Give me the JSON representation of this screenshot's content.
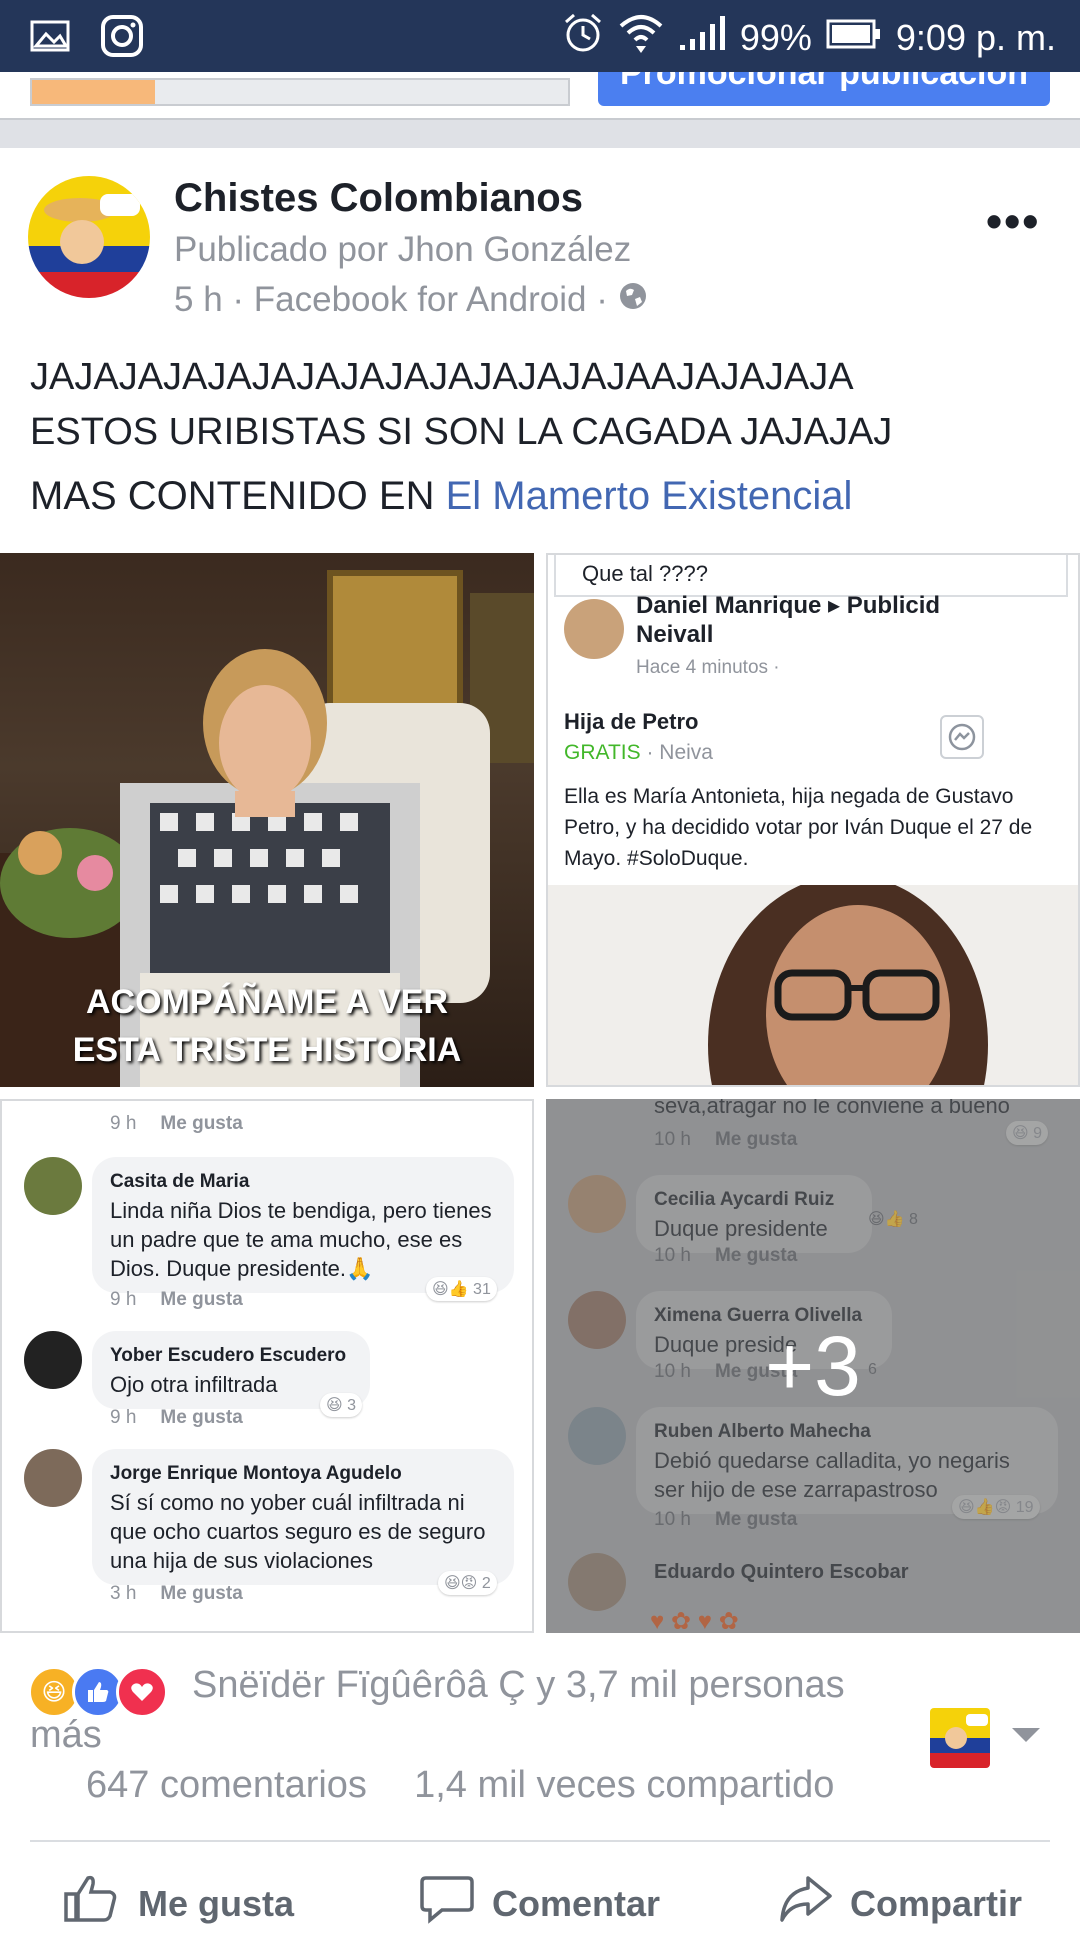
{
  "status_bar": {
    "battery": "99%",
    "time": "9:09 p. m."
  },
  "top": {
    "promote_label": "Promocionar publicación"
  },
  "post": {
    "page_name": "Chistes Colombianos",
    "byline": "Publicado por Jhon González",
    "meta": "5 h · Facebook for Android ·",
    "text_line1": "JAJAJAJAJAJAJAJAJAJAJAJAJAJAAJAJAJAJA",
    "text_line2": "ESTOS URIBISTAS SI SON LA CAGADA JAJAJAJ",
    "more_prefix": "MAS CONTENIDO EN ",
    "more_link": "El Mamerto Existencial"
  },
  "media": {
    "m1_caption1": "ACOMPÁÑAME A VER",
    "m1_caption2": "ESTA TRISTE HISTORIA",
    "m2": {
      "question": "Que tal ????",
      "author": "Daniel Manrique ▸ Publicid",
      "author2": "Neivall",
      "time": "Hace 4 minutos ·",
      "title": "Hija de Petro",
      "price": "GRATIS",
      "location": "· Neiva",
      "body": "Ella es María Antonieta, hija negada de Gustavo Petro, y ha decidido votar por Iván Duque el 27 de Mayo. #SoloDuque."
    },
    "m3": {
      "top_meta": "9 h",
      "like": "Me gusta",
      "comments": [
        {
          "name": "Casita de Maria",
          "text": "Linda niña Dios te bendiga, pero tienes un padre que te ama mucho, ese es Dios. Duque presidente.🙏",
          "time": "9 h",
          "reacts": "31"
        },
        {
          "name": "Yober Escudero Escudero",
          "text": "Ojo otra infiltrada",
          "time": "9 h",
          "reacts": "3"
        },
        {
          "name": "Jorge Enrique Montoya Agudelo",
          "text": "Sí sí como no yober cuál infiltrada ni que ocho cuartos seguro es de seguro una hija de sus violaciones",
          "time": "3 h",
          "reacts": "2"
        }
      ]
    },
    "m4": {
      "top_text": "seva,atragar no le conviene a bueno",
      "top_meta": "10 h",
      "top_reacts": "9",
      "comments": [
        {
          "name": "Cecilia Aycardi Ruiz",
          "text": "Duque presidente",
          "time": "10 h",
          "reacts": "8"
        },
        {
          "name": "Ximena Guerra Olivella",
          "text": "Duque preside",
          "time": "10 h",
          "reacts": "6"
        },
        {
          "name": "Ruben Alberto Mahecha",
          "text": "Debió quedarse calladita, yo negaris ser hijo de ese zarrapastroso",
          "time": "10 h",
          "reacts": "19"
        },
        {
          "name": "Eduardo Quintero Escobar",
          "text": "",
          "time": "",
          "reacts": ""
        }
      ],
      "overlay": "+3"
    }
  },
  "engagement": {
    "reactors": "Snëïdër Fïgûêrôâ Ç y 3,7 mil personas",
    "reactors_more": "más",
    "comments": "647 comentarios",
    "shares": "1,4 mil veces compartido"
  },
  "actions": {
    "like": "Me gusta",
    "comment": "Comentar",
    "share": "Compartir"
  },
  "colors": {
    "status_bar": "#243659",
    "link": "#4267b2",
    "promote": "#4b7ff0"
  }
}
